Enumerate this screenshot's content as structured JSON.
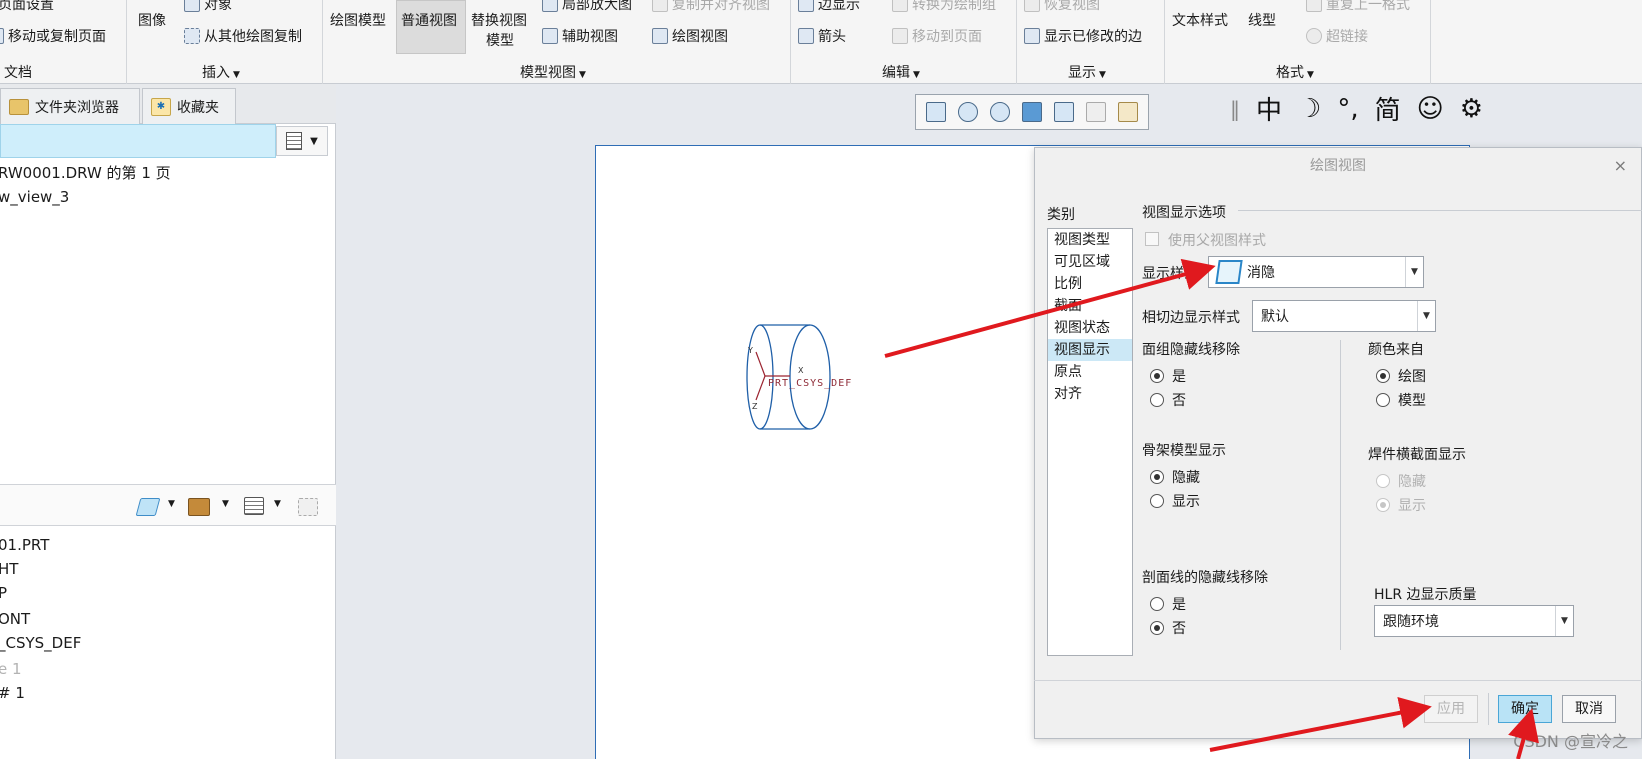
{
  "ribbon": {
    "doc_items": [
      "页面设置",
      "移动或复制页面"
    ],
    "insert_items": [
      "图像",
      "对象",
      "从其他绘图复制"
    ],
    "model_view_items": [
      "绘图模型",
      "普通视图",
      "替换视图",
      "模型",
      "局部放大图",
      "复制并对齐视图",
      "辅助视图",
      "绘图视图"
    ],
    "edit_items": [
      "边显示",
      "转换为绘制组",
      "箭头",
      "移动到页面"
    ],
    "display_items": [
      "恢复视图",
      "显示已修改的边"
    ],
    "format_items": [
      "文本样式",
      "线型",
      "重复上一格式",
      "超链接"
    ],
    "groups": [
      "文档",
      "插入",
      "模型视图",
      "编辑",
      "显示",
      "格式"
    ]
  },
  "left_pane": {
    "tabs": [
      "文件夹浏览器",
      "收藏夹"
    ],
    "tree_top": [
      "RW0001.DRW 的第 1 页",
      "w_view_3"
    ],
    "tree_bottom": [
      "01.PRT",
      "HT",
      "P",
      "ONT",
      "_CSYS_DEF",
      "e 1",
      "# 1"
    ]
  },
  "ime_bar": [
    "‖",
    "中",
    "☽",
    "°,",
    "简",
    "☺",
    "⚙"
  ],
  "drawing": {
    "csys_label": "PRT_CSYS_DEF",
    "axis_x": "X",
    "axis_y": "Y",
    "axis_z": "Z"
  },
  "dialog": {
    "title": "绘图视图",
    "close": "×",
    "category_label": "类别",
    "categories": [
      "视图类型",
      "可见区域",
      "比例",
      "截面",
      "视图状态",
      "视图显示",
      "原点",
      "对齐"
    ],
    "selected_category": "视图显示",
    "section_title": "视图显示选项",
    "use_parent_style": "使用父视图样式",
    "display_style_label": "显示样式",
    "display_style_value": "消隐",
    "tangent_label": "相切边显示样式",
    "tangent_value": "默认",
    "quilt_hidden_label": "面组隐藏线移除",
    "quilt_yes": "是",
    "quilt_no": "否",
    "color_from_label": "颜色来自",
    "color_drawing": "绘图",
    "color_model": "模型",
    "skeleton_label": "骨架模型显示",
    "skeleton_hide": "隐藏",
    "skeleton_show": "显示",
    "weld_label": "焊件横截面显示",
    "weld_hide": "隐藏",
    "weld_show": "显示",
    "section_hidden_label": "剖面线的隐藏线移除",
    "section_yes": "是",
    "section_no": "否",
    "hlr_label": "HLR 边显示质量",
    "hlr_value": "跟随环境",
    "btn_apply": "应用",
    "btn_ok": "确定",
    "btn_cancel": "取消"
  },
  "watermark": "CSDN @宣冷之",
  "colors": {
    "arrow": "#e0191e",
    "accent": "#2f6db5",
    "selected": "#cce8f6"
  }
}
